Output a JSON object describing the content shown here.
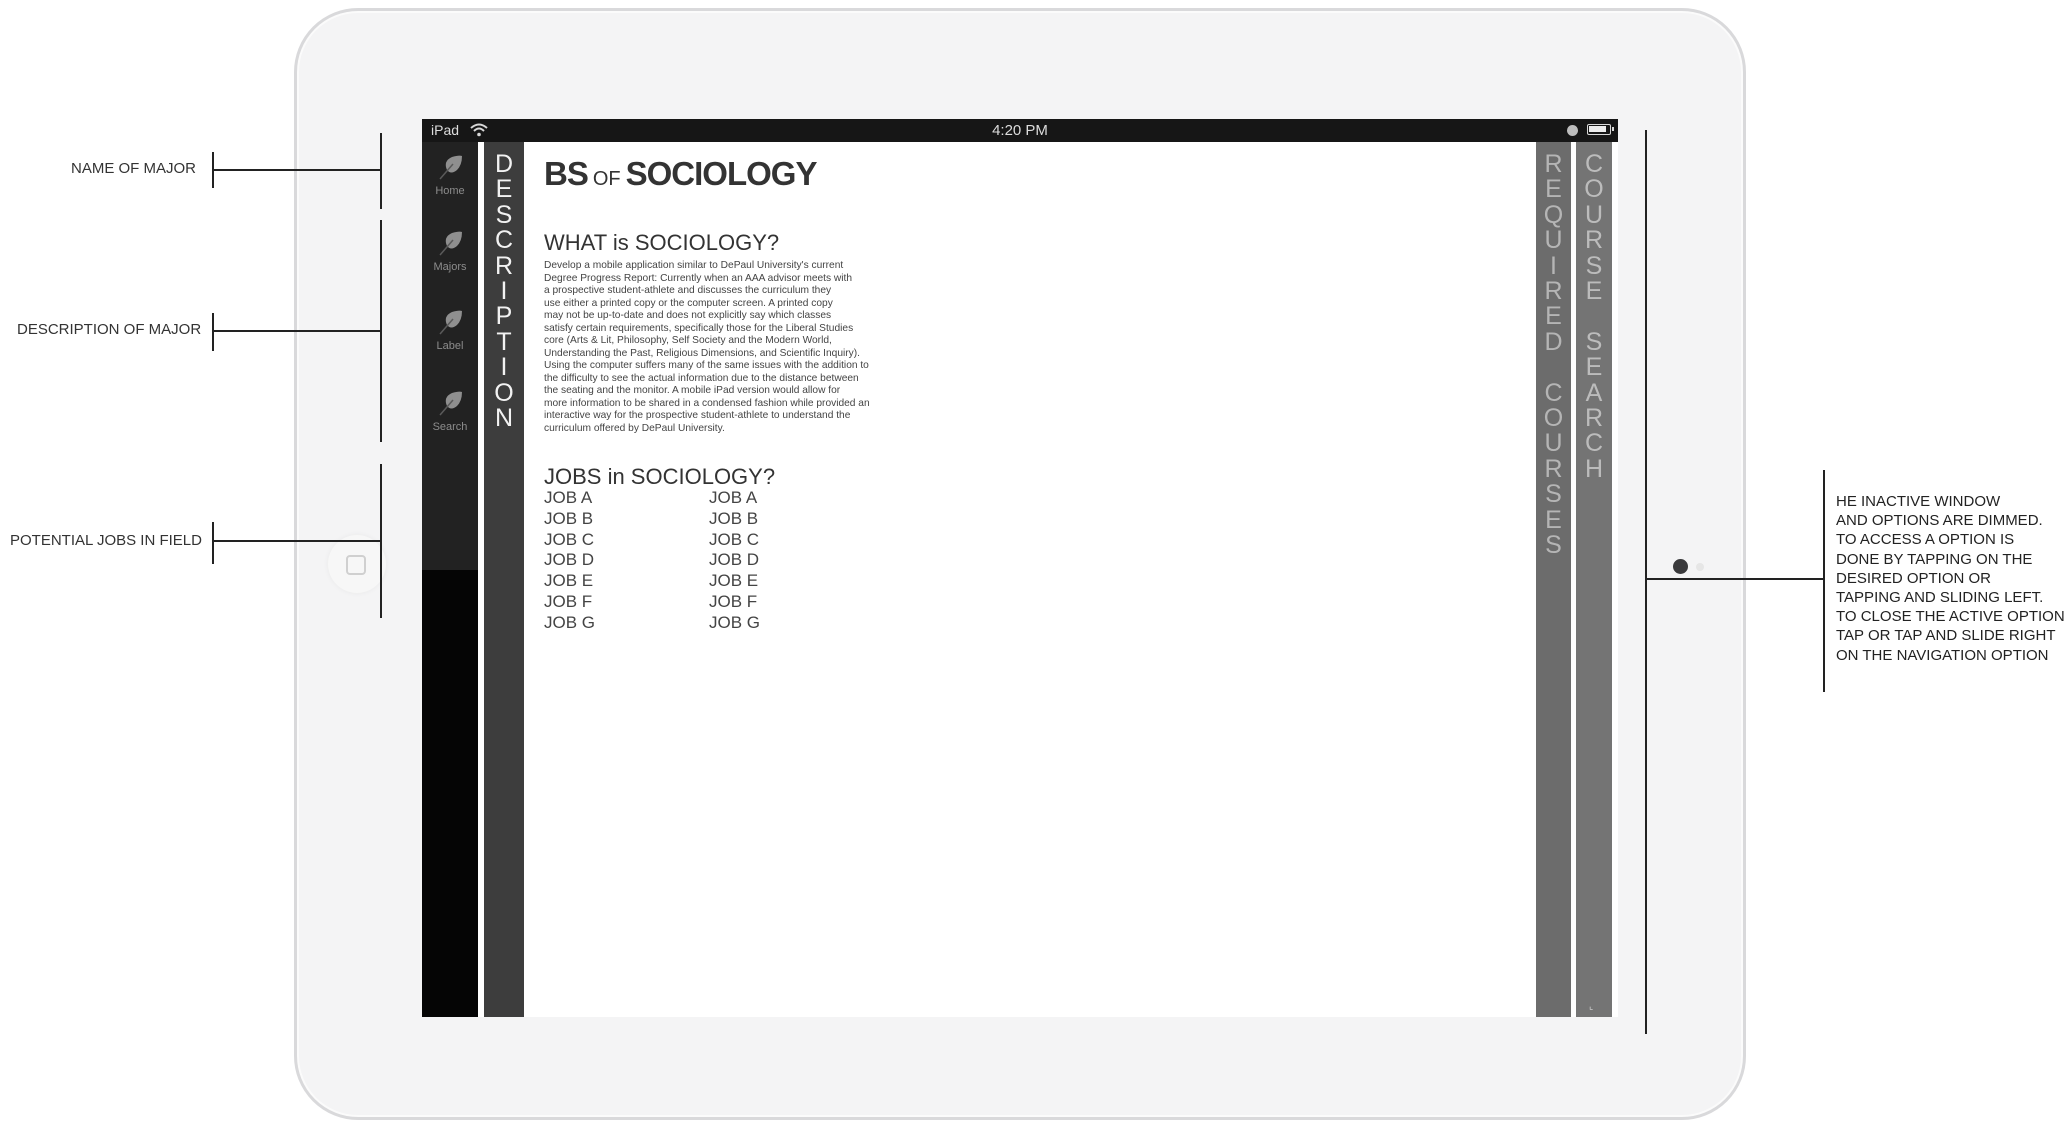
{
  "status_bar": {
    "device": "iPad",
    "time": "4:20 PM"
  },
  "sidebar": {
    "items": [
      {
        "label": "Home",
        "icon": "leaf-icon"
      },
      {
        "label": "Majors",
        "icon": "leaf-icon"
      },
      {
        "label": "Label",
        "icon": "leaf-icon"
      },
      {
        "label": "Search",
        "icon": "leaf-icon"
      }
    ]
  },
  "tabs": {
    "description": "DESCRIPTION",
    "required_courses": "REQUIRED COURSES",
    "course_search": "COURSE SEARCH"
  },
  "content": {
    "title_prefix": "BS",
    "title_of": "OF",
    "title_major": "SOCIOLOGY",
    "description_heading": "WHAT is SOCIOLOGY?",
    "description_lines": [
      "Develop a mobile application similar to DePaul University's current",
      "Degree Progress Report: Currently when an AAA advisor meets with",
      "a prospective student-athlete and discusses the curriculum they",
      "use either a printed copy or the computer screen.  A printed copy",
      "may not be up-to-date and does not explicitly say which classes",
      "satisfy certain requirements, specifically those for the Liberal Studies",
      "core (Arts & Lit, Philosophy, Self Society and the Modern World,",
      "Understanding the Past, Religious Dimensions, and Scientific Inquiry).",
      "Using the computer suffers many of the same issues with the addition to",
      "the difficulty to see the actual information due to the distance between",
      "the seating and the monitor.  A mobile iPad version would allow for",
      "more information to be shared in a condensed fashion while provided an",
      "interactive way for the prospective student-athlete to understand the",
      "curriculum offered by DePaul University."
    ],
    "jobs_heading": "JOBS in SOCIOLOGY?",
    "jobs_col1": [
      "JOB A",
      "JOB B",
      "JOB C",
      "JOB D",
      "JOB E",
      "JOB F",
      "JOB G"
    ],
    "jobs_col2": [
      "JOB A",
      "JOB B",
      "JOB C",
      "JOB D",
      "JOB E",
      "JOB F",
      "JOB G"
    ]
  },
  "annotations": {
    "name_of_major": "NAME OF MAJOR",
    "description_of_major": "DESCRIPTION OF MAJOR",
    "potential_jobs": "POTENTIAL JOBS IN FIELD",
    "note_lines": [
      "HE INACTIVE WINDOW",
      "AND OPTIONS ARE DIMMED.",
      "TO ACCESS A OPTION IS",
      "DONE BY TAPPING ON THE",
      "DESIRED OPTION OR",
      "TAPPING AND SLIDING LEFT.",
      "TO CLOSE THE ACTIVE OPTION",
      "TAP OR TAP AND SLIDE RIGHT",
      "ON THE NAVIGATION OPTION"
    ]
  },
  "colors": {
    "status_bar": "#161616",
    "sidebar": "#222222",
    "description_tab": "#3d3d3d",
    "inactive_tab": "#6c6c6c"
  }
}
